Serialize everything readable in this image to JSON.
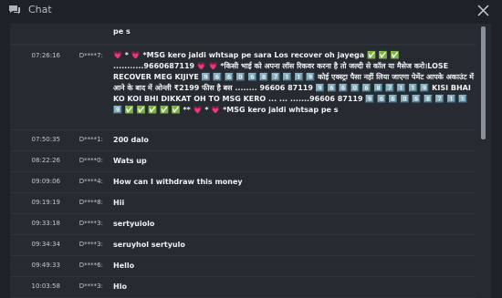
{
  "window": {
    "title": "Chat"
  },
  "messages": [
    {
      "time": "",
      "user": "",
      "text": "pe s"
    },
    {
      "time": "07:26:16",
      "user": "D****7:",
      "text": "💗 * 💗 *MSG kero jaldi whtsap pe sara Los recover oh jayega ✅ ✅ ✅ ...........9660687119 💗 💗 *किसी भाई को अपना लॉस रिकवर करना है तो जल्दी से कॉल या मैसेज करो।LOSE RECOVER MEG KIJIYE 9️⃣ 6️⃣ 6️⃣ 0️⃣ 6️⃣ 8️⃣ 7️⃣ 1️⃣ 1️⃣ 9️⃣ कोई एक्स्ट्रा पैसा नहीं लिया जाएगा पेमेंट आपके अकाउंट में आने के बाद में ओन्ली ₹2199 फीस है बस ........ 96606 87119 9️⃣ 6️⃣ 6️⃣ 0️⃣ 6️⃣ 8️⃣ 7️⃣ 1️⃣ 1️⃣ 9️⃣ KISI BHAI KO KOI BHI DIKKAT OH TO MSG KERO ... ... .......96606 87119 9️⃣ 6️⃣ 6️⃣ 0️⃣ 6️⃣ 8️⃣ 7️⃣ 1️⃣ 1️⃣ 9️⃣ ✅ ✅ ✅ ✅ ✅ ** 💗 * 💗 *MSG kero jaldi whtsap pe s"
    },
    {
      "time": "07:50:35",
      "user": "D****1:",
      "text": "200 dalo"
    },
    {
      "time": "08:22:26",
      "user": "D****0:",
      "text": "Wats up"
    },
    {
      "time": "09:09:06",
      "user": "D****4:",
      "text": "How can I withdraw this money"
    },
    {
      "time": "09:19:19",
      "user": "D****8:",
      "text": "Hii"
    },
    {
      "time": "09:33:18",
      "user": "D****3:",
      "text": "sertyuiolo"
    },
    {
      "time": "09:34:34",
      "user": "D****3:",
      "text": "seruyhol sertyulo"
    },
    {
      "time": "09:49:33",
      "user": "D****6:",
      "text": "Hello"
    },
    {
      "time": "10:03:58",
      "user": "D****3:",
      "text": "Hlo"
    }
  ]
}
